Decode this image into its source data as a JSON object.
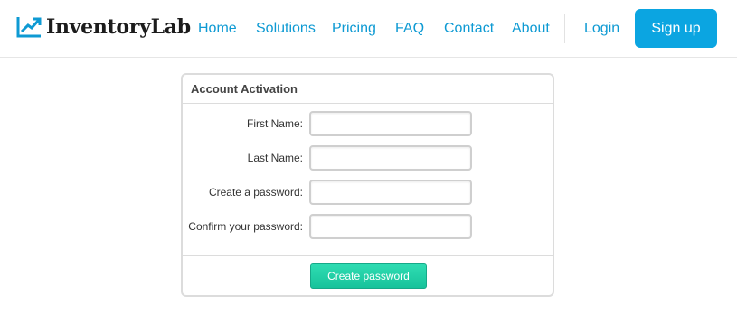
{
  "brand": {
    "name": "InventoryLab",
    "accent_color": "#0ba5e1",
    "logo_icon": "chart-trend-icon"
  },
  "nav": {
    "items": [
      {
        "label": "Home"
      },
      {
        "label": "Solutions"
      },
      {
        "label": "Pricing"
      },
      {
        "label": "FAQ"
      },
      {
        "label": "Contact"
      },
      {
        "label": "About"
      }
    ],
    "login_label": "Login",
    "signup_label": "Sign up"
  },
  "form": {
    "title": "Account Activation",
    "fields": [
      {
        "label": "First Name:",
        "value": ""
      },
      {
        "label": "Last Name:",
        "value": ""
      },
      {
        "label": "Create a password:",
        "value": ""
      },
      {
        "label": "Confirm your password:",
        "value": ""
      }
    ],
    "submit_label": "Create password",
    "submit_color": "#1fcfa6"
  }
}
